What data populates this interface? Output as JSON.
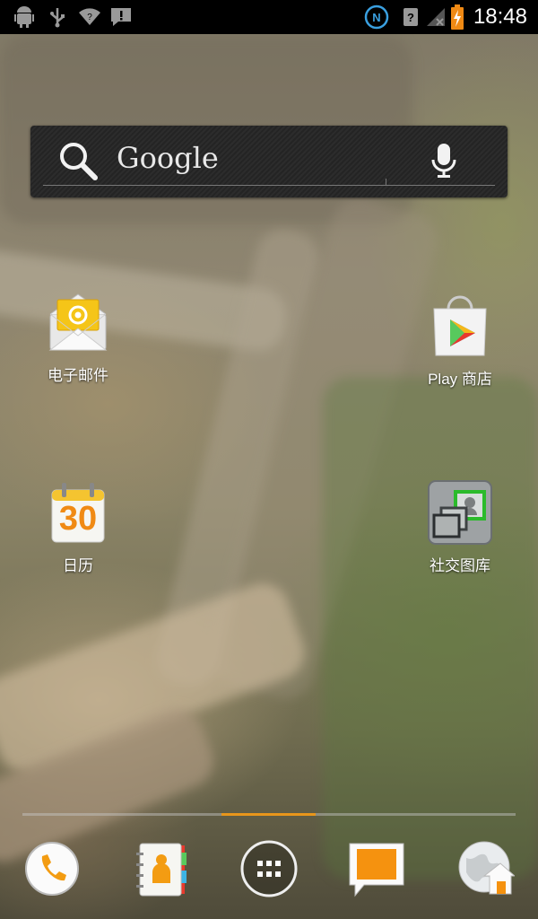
{
  "statusbar": {
    "time": "18:48",
    "left_icons": [
      "android-debug-icon",
      "usb-icon",
      "wifi-icon",
      "alert-icon"
    ],
    "right_icons": [
      "nfc-icon",
      "signal-unknown-icon",
      "no-signal-icon",
      "battery-charging-icon"
    ]
  },
  "search": {
    "brand": "Google"
  },
  "shortcuts": [
    {
      "label": "电子邮件",
      "icon": "email-icon"
    },
    {
      "label": "Play 商店",
      "icon": "play-store-icon"
    },
    {
      "label": "日历",
      "icon": "calendar-icon",
      "calendar_day": "30"
    },
    {
      "label": "社交图库",
      "icon": "social-gallery-icon"
    }
  ],
  "dock": {
    "items": [
      "phone-icon",
      "contacts-icon",
      "app-drawer-icon",
      "messaging-icon",
      "browser-icon"
    ]
  },
  "colors": {
    "accent": "#e8961b",
    "statusbar_bg": "#000000",
    "search_bg": "#2a2a2a"
  }
}
